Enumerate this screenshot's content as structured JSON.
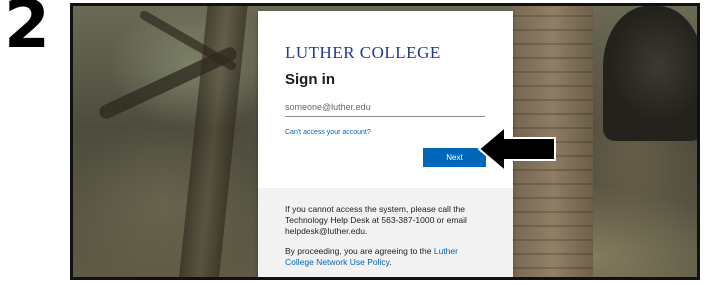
{
  "step": {
    "number": "2"
  },
  "signin": {
    "logo_text": "LUTHER COLLEGE",
    "title": "Sign in",
    "email_placeholder": "someone@luther.edu",
    "cant_access_link": "Can't access your account?",
    "next_label": "Next"
  },
  "footer": {
    "help_text": "If you cannot access the system, please call the Technology Help Desk at 563-387-1000 or email helpdesk@luther.edu.",
    "policy_prefix": "By proceeding, you are agreeing to the ",
    "policy_link": "Luther College Network Use Policy",
    "policy_suffix": "."
  },
  "colors": {
    "accent": "#0067b8",
    "logo": "#1f3a93",
    "footer_bg": "#f2f2f2"
  },
  "icons": {
    "pointer": "arrow-pointer-icon"
  }
}
